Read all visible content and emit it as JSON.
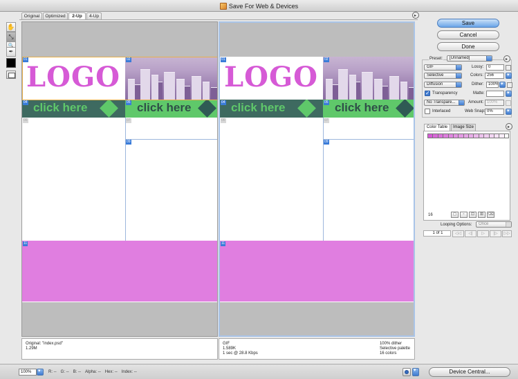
{
  "window": {
    "title": "Save For Web & Devices"
  },
  "tabs": [
    {
      "label": "Original",
      "active": false
    },
    {
      "label": "Optimized",
      "active": false
    },
    {
      "label": "2-Up",
      "active": true
    },
    {
      "label": "4-Up",
      "active": false
    }
  ],
  "tools": [
    {
      "name": "hand-tool",
      "glyph": "✋"
    },
    {
      "name": "slice-select-tool",
      "glyph": "⤡"
    },
    {
      "name": "zoom-tool",
      "glyph": "🔍"
    },
    {
      "name": "eyedropper-tool",
      "glyph": "✒"
    }
  ],
  "artwork": {
    "logo_text": "LOGO",
    "button_text": "click here",
    "slices": [
      "01",
      "02",
      "04",
      "05",
      "06",
      "07",
      "09",
      "11"
    ]
  },
  "left_info": {
    "line1": "Original: \"index.psd\"",
    "line2": "1.29M"
  },
  "right_info": {
    "line1": "GIF",
    "line2": "1.589K",
    "line3": "1 sec @ 28.8 Kbps",
    "r_line1": "100% dither",
    "r_line2": "Selective palette",
    "r_line3": "16 colors"
  },
  "buttons": {
    "save": "Save",
    "cancel": "Cancel",
    "done": "Done",
    "device_central": "Device Central..."
  },
  "settings": {
    "preset_label": "Preset:",
    "preset_value": "[Unnamed]",
    "format": "GIF",
    "lossy_label": "Lossy:",
    "lossy_value": "0",
    "palette": "Selective",
    "colors_label": "Colors:",
    "colors_value": "256",
    "dither_algo": "Diffusion",
    "dither_label": "Dither:",
    "dither_value": "100%",
    "transparency_label": "Transparency",
    "transparency_checked": true,
    "matte_label": "Matte:",
    "trans_dither": "No Transpare...",
    "amount_label": "Amount:",
    "amount_value": "100%",
    "interlaced_label": "Interlaced",
    "interlaced_checked": false,
    "websnap_label": "Web Snap:",
    "websnap_value": "0%"
  },
  "color_table": {
    "tabs": [
      "Color Table",
      "Image Size"
    ],
    "count": "16",
    "swatches": [
      "#d65ad6",
      "#d868d8",
      "#db72db",
      "#dd7ddd",
      "#e086e0",
      "#e290e2",
      "#e49ae4",
      "#e6a4e6",
      "#e9aee9",
      "#ebb8eb",
      "#edc2ed",
      "#f0ccf0",
      "#f3d6f3",
      "#f6e1f6",
      "#faeefa",
      "#ffffff"
    ]
  },
  "animation": {
    "looping_label": "Looping Options:",
    "looping_value": "Once",
    "frame": "1 of 1"
  },
  "status": {
    "zoom": "100%",
    "r_label": "R:",
    "r_value": "--",
    "g_label": "G:",
    "g_value": "--",
    "b_label": "B:",
    "b_value": "--",
    "alpha_label": "Alpha:",
    "alpha_value": "--",
    "hex_label": "Hex:",
    "hex_value": "--",
    "index_label": "Index:",
    "index_value": "--"
  }
}
